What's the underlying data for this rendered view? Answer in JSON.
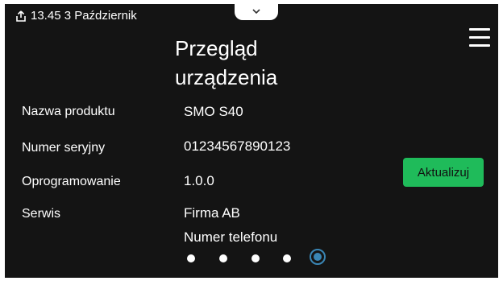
{
  "status_bar": {
    "time_date": "13.45 3 Październik",
    "home_icon": "home-export-icon",
    "pull_tab_icon": "chevron-down-icon"
  },
  "header": {
    "title": "Przegląd urządzenia",
    "menu_icon": "hamburger-menu-icon"
  },
  "info": {
    "product_name_label": "Nazwa produktu",
    "product_name_value": "SMO S40",
    "serial_label": "Numer seryjny",
    "serial_value": "01234567890123",
    "software_label": "Oprogramowanie",
    "software_value": "1.0.0",
    "service_label": "Serwis",
    "service_company": "Firma AB",
    "service_phone": "Numer telefonu"
  },
  "actions": {
    "update_label": "Aktualizuj"
  },
  "pagination": {
    "total_pages": 5,
    "current_page": 5
  },
  "colors": {
    "background": "#141414",
    "accent_green": "#1fbb5a",
    "active_dot": "#3a86b5"
  }
}
